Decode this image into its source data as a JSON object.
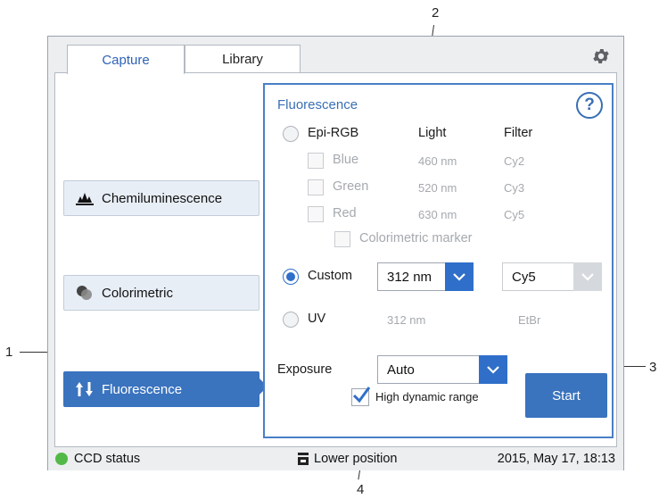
{
  "callouts": {
    "c1": "1",
    "c2": "2",
    "c3": "3",
    "c4": "4"
  },
  "tabs": [
    {
      "label": "Capture",
      "active": true
    },
    {
      "label": "Library",
      "active": false
    }
  ],
  "icons": {
    "settings": "gear-icon",
    "chemiluminescence": "chemi-icon",
    "colorimetric": "colorimetric-icon",
    "fluorescence": "fluorescence-icon",
    "help": "help-icon",
    "dropdown": "chevron-down-icon",
    "checkmark": "checkmark-icon",
    "status": "status-dot-icon",
    "position": "position-icon"
  },
  "modes": [
    {
      "label": "Chemiluminescence",
      "active": false
    },
    {
      "label": "Colorimetric",
      "active": false
    },
    {
      "label": "Fluorescence",
      "active": true
    }
  ],
  "panel": {
    "title": "Fluorescence",
    "help": "?",
    "epi": {
      "label": "Epi-RGB",
      "selected": false,
      "col_light": "Light",
      "col_filter": "Filter",
      "rows": [
        {
          "label": "Blue",
          "light": "460 nm",
          "filter": "Cy2"
        },
        {
          "label": "Green",
          "light": "520 nm",
          "filter": "Cy3"
        },
        {
          "label": "Red",
          "light": "630 nm",
          "filter": "Cy5"
        }
      ],
      "marker": "Colorimetric marker"
    },
    "custom": {
      "label": "Custom",
      "selected": true,
      "light_value": "312 nm",
      "filter_value": "Cy5"
    },
    "uv": {
      "label": "UV",
      "selected": false,
      "light": "312 nm",
      "filter": "EtBr"
    },
    "exposure": {
      "label": "Exposure",
      "value": "Auto"
    },
    "hdr": {
      "label": "High dynamic range",
      "checked": true
    },
    "start": "Start"
  },
  "status": {
    "ccd": "CCD status",
    "ccd_color": "#52b947",
    "position": "Lower position",
    "datetime": "2015, May 17, 18:13"
  },
  "colors": {
    "accent": "#3a73be",
    "panel_border": "#4a7fc4"
  }
}
